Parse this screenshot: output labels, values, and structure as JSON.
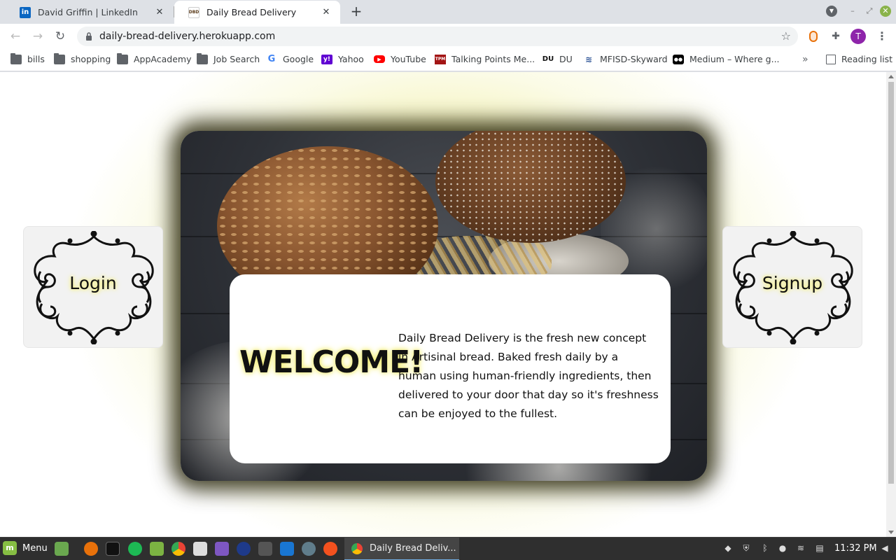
{
  "browser": {
    "tabs": [
      {
        "title": "David Griffin | LinkedIn",
        "favicon": "in",
        "active": false
      },
      {
        "title": "Daily Bread Delivery",
        "favicon": "DBD",
        "active": true
      }
    ],
    "new_tab": "+",
    "url": "daily-bread-delivery.herokuapp.com",
    "profile_initial": "T",
    "bookmarks": [
      {
        "label": "bills",
        "icon": "folder-icon"
      },
      {
        "label": "shopping",
        "icon": "folder-icon"
      },
      {
        "label": "AppAcademy",
        "icon": "folder-icon"
      },
      {
        "label": "Job Search",
        "icon": "folder-icon"
      },
      {
        "label": "Google",
        "icon": "google-icon"
      },
      {
        "label": "Yahoo",
        "icon": "yahoo-icon"
      },
      {
        "label": "YouTube",
        "icon": "youtube-icon"
      },
      {
        "label": "Talking Points Me...",
        "icon": "tpm-icon"
      },
      {
        "label": "DU",
        "icon": "du-icon"
      },
      {
        "label": "MFISD-Skyward",
        "icon": "skyward-icon"
      },
      {
        "label": "Medium – Where g...",
        "icon": "medium-icon"
      }
    ],
    "more_bookmarks": "»",
    "reading_list": "Reading list"
  },
  "page": {
    "welcome": "WELCOME!",
    "description": "Daily Bread Delivery is the fresh new concept in Artisinal bread. Baked fresh daily by a human using human-friendly ingredients, then delivered to your door that day so it's freshness can be enjoyed to the fullest.",
    "login_label": "Login",
    "signup_label": "Signup"
  },
  "taskbar": {
    "menu_label": "Menu",
    "window_title": "Daily Bread Deliv...",
    "clock": "11:32 PM"
  },
  "colors": {
    "accent_glow": "#f4ef7a",
    "page_bg_center": "#efec98",
    "profile": "#8e24aa"
  }
}
